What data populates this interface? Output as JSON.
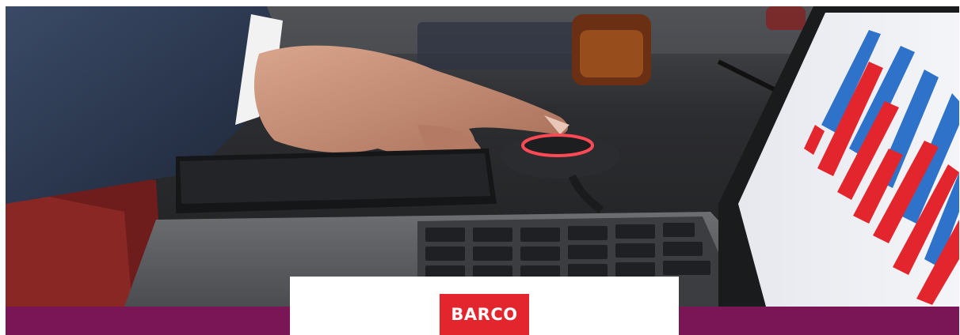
{
  "banner": {
    "brand": "BARCO",
    "colors": {
      "band": "#7a1656",
      "logo_background": "#e3262d",
      "logo_text": "#ffffff",
      "card": "#ffffff"
    }
  },
  "photo": {
    "subject_icons": [
      "hand-icon",
      "tablet-icon",
      "button-device-icon",
      "laptop-icon",
      "bar-chart-icon"
    ]
  }
}
